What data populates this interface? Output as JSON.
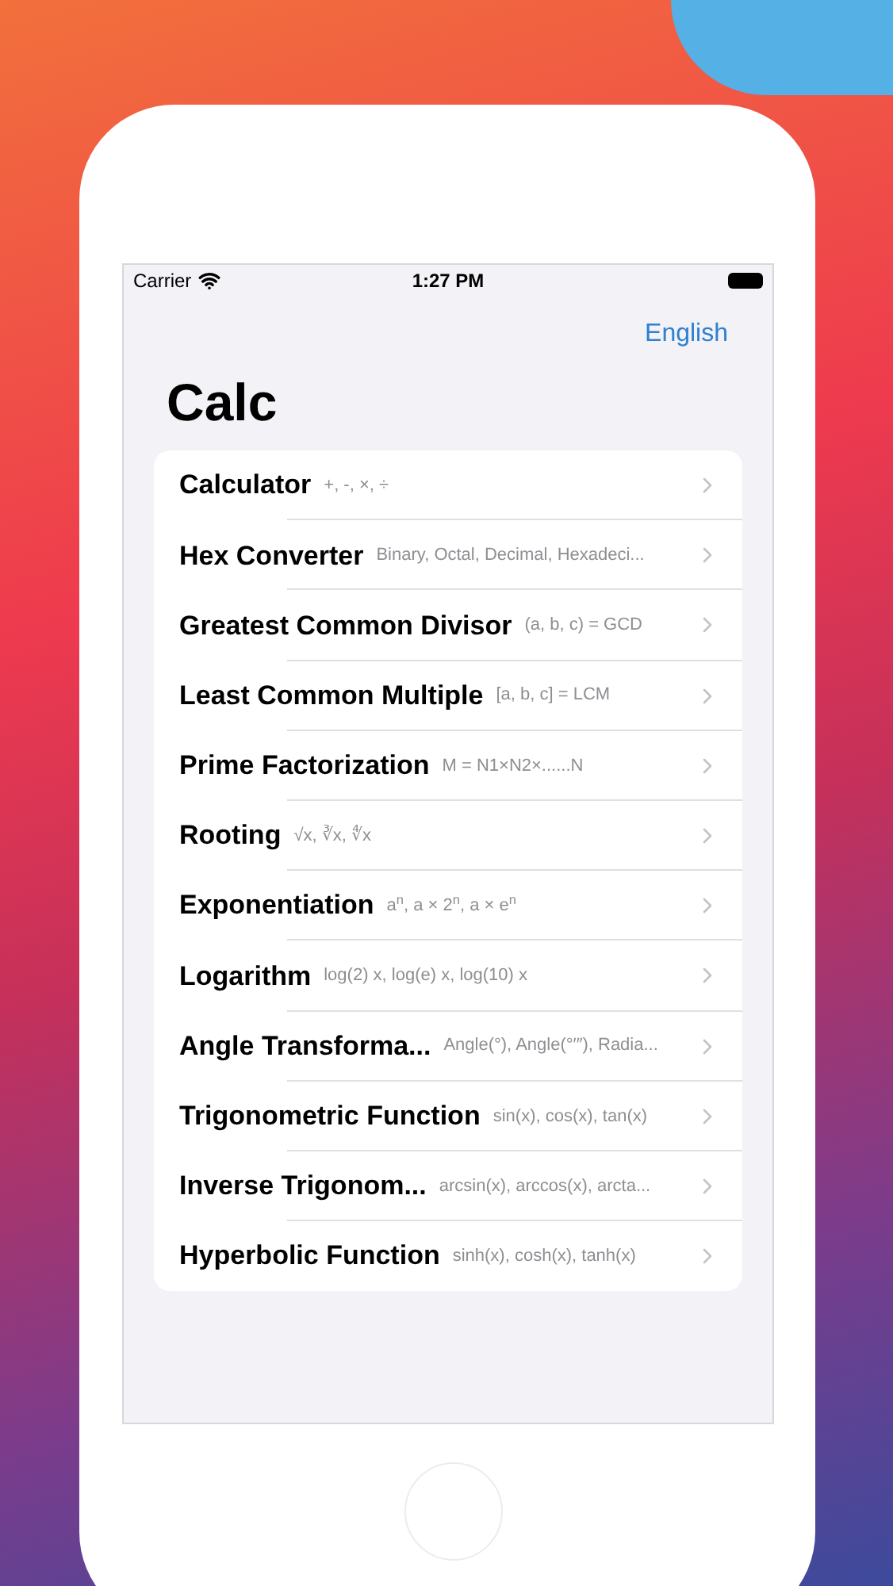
{
  "status_bar": {
    "carrier": "Carrier",
    "time": "1:27 PM"
  },
  "nav": {
    "language_button": "English",
    "title": "Calc"
  },
  "items": [
    {
      "title": "Calculator",
      "subtitle": "+, -, ×, ÷"
    },
    {
      "title": "Hex Converter",
      "subtitle": "Binary, Octal, Decimal, Hexadeci..."
    },
    {
      "title": "Greatest Common Divisor",
      "subtitle": "(a, b, c) = GCD"
    },
    {
      "title": "Least Common Multiple",
      "subtitle": "[a, b, c] = LCM"
    },
    {
      "title": "Prime Factorization",
      "subtitle": "M = N1×N2×......N"
    },
    {
      "title": "Rooting",
      "subtitle": "√x, ∛x, ∜x"
    },
    {
      "title": "Exponentiation",
      "subtitle": "a$^{n}$, a × 2$^{n}$, a × e$^{n}$"
    },
    {
      "title": "Logarithm",
      "subtitle": "log(2) x, log(e) x, log(10) x"
    },
    {
      "title": "Angle Transforma...",
      "subtitle": "Angle(°), Angle(°′″), Radia..."
    },
    {
      "title": "Trigonometric Function",
      "subtitle": "sin(x), cos(x), tan(x)"
    },
    {
      "title": "Inverse Trigonom...",
      "subtitle": "arcsin(x), arccos(x), arcta..."
    },
    {
      "title": "Hyperbolic Function",
      "subtitle": "sinh(x), cosh(x), tanh(x)"
    }
  ]
}
